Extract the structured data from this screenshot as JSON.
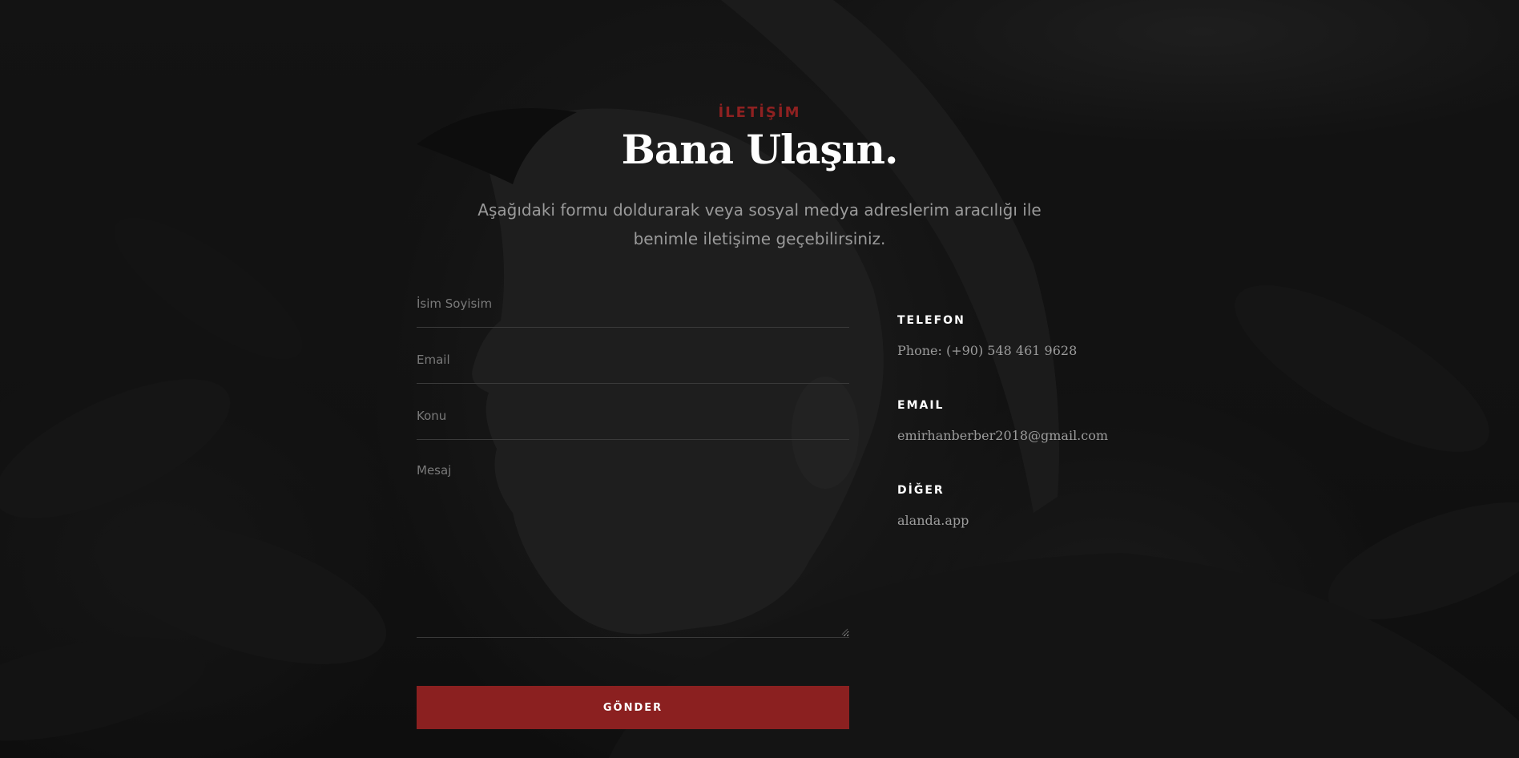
{
  "section": {
    "eyebrow": "İLETİŞİM",
    "title": "Bana Ulaşın.",
    "intro": "Aşağıdaki formu doldurarak veya sosyal medya adreslerim aracılığı ile benimle iletişime geçebilirsiniz."
  },
  "form": {
    "name_placeholder": "İsim Soyisim",
    "email_placeholder": "Email",
    "subject_placeholder": "Konu",
    "message_placeholder": "Mesaj",
    "submit_label": "GÖNDER"
  },
  "contact": {
    "items": [
      {
        "label": "TELEFON",
        "value": "Phone: (+90) 548 461 9628"
      },
      {
        "label": "EMAIL",
        "value": "emirhanberber2018@gmail.com"
      },
      {
        "label": "DİĞER",
        "value": "alanda.app"
      }
    ]
  },
  "colors": {
    "accent": "#8b2020",
    "background": "#141414",
    "text_muted": "#9a9a9a",
    "text_light": "#ffffff"
  },
  "background": {
    "icon": "portrait-photo"
  }
}
